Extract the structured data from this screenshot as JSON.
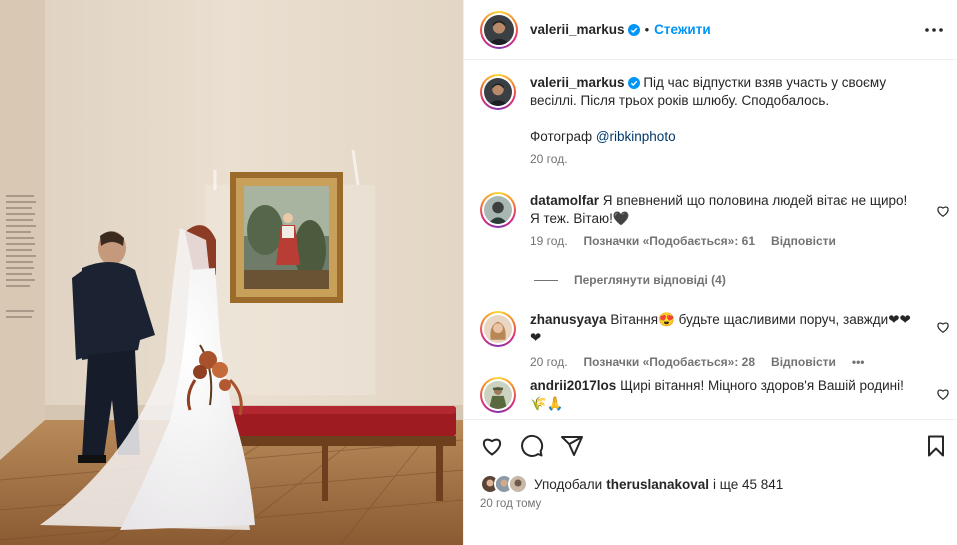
{
  "post_author": {
    "username": "valerii_markus",
    "verified": true,
    "follow_label": "Стежити",
    "separator": "•"
  },
  "caption": {
    "username": "valerii_markus",
    "text": "Під час відпустки взяв участь у своєму весіллі. Після трьох років шлюбу. Сподобалось.",
    "photographer_prefix": "Фотограф",
    "photographer_mention": "@ribkinphoto",
    "time": "20 год."
  },
  "comments": [
    {
      "username": "datamolfar",
      "text": "Я впевнений що половина людей вітає не щиро! Я теж. Вітаю!🖤",
      "time": "19 год.",
      "likes": "Позначки «Подобається»: 61",
      "reply": "Відповісти"
    },
    {
      "username": "zhanusyaya",
      "text": "Вітання😍 будьте щасливими поруч, завжди❤❤❤",
      "time": "20 год.",
      "likes": "Позначки «Подобається»: 28",
      "reply": "Відповісти",
      "more": "•••"
    },
    {
      "username": "andrii2017los",
      "text": "Щирі вітання! Міцного здоров'я Вашій родині! 🌾🙏"
    }
  ],
  "view_replies": "Переглянути відповіді (4)",
  "likes_summary": {
    "prefix": "Уподобали",
    "user": "theruslanakoval",
    "rest": "і ще 45 841"
  },
  "post_time": "20 год тому",
  "icons": [
    "heart-icon",
    "comment-icon",
    "share-icon",
    "bookmark-icon",
    "more-icon",
    "verified-icon"
  ],
  "colors": {
    "accent": "#0095f6",
    "text": "#262626",
    "muted": "#737373",
    "bench": "#9e1b22"
  }
}
